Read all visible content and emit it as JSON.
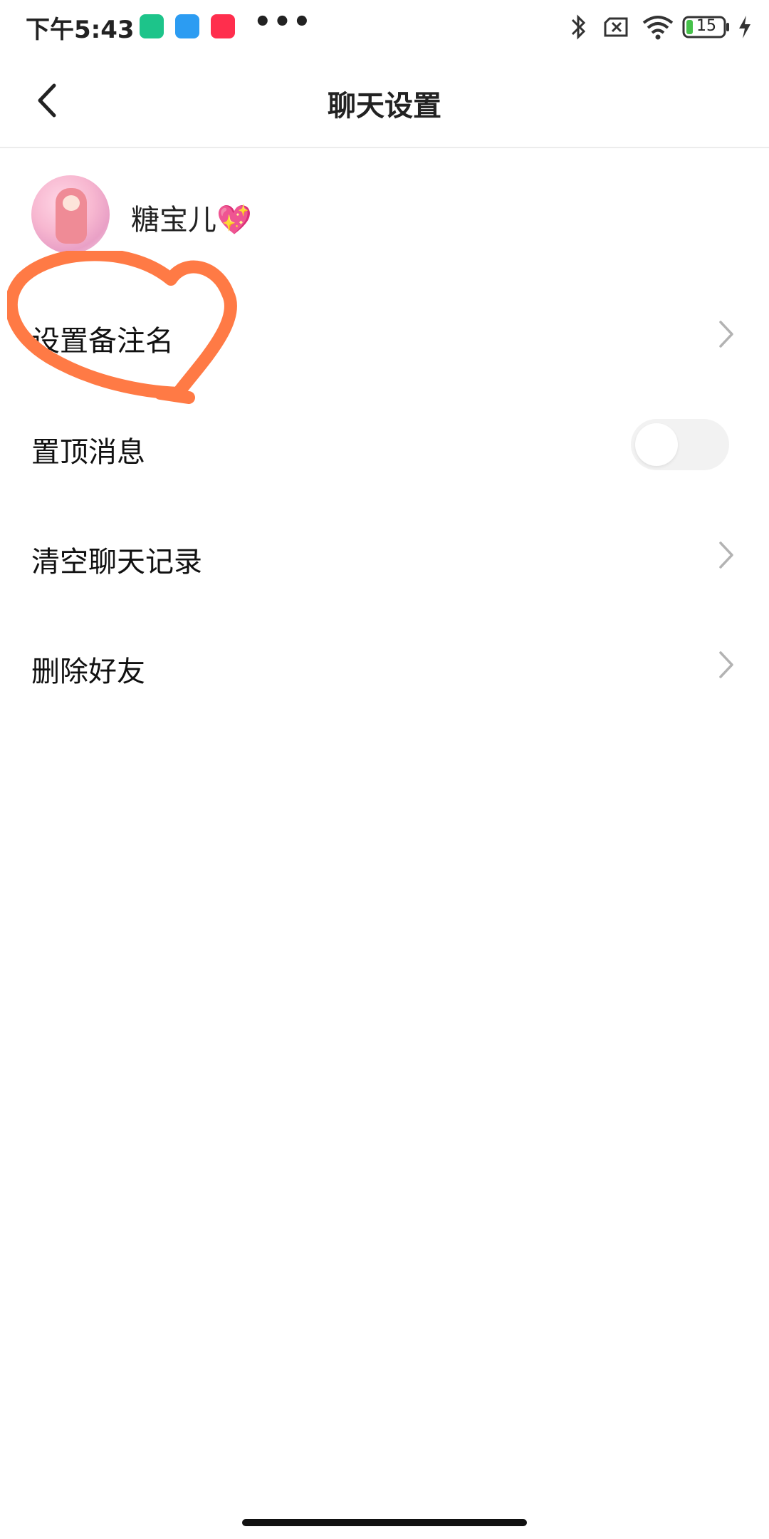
{
  "status_bar": {
    "time": "下午5:43",
    "more": "•••",
    "battery_level": "15",
    "icons": [
      "shield-app-icon",
      "blue-app-icon",
      "xiaohongshu-app-icon",
      "bluetooth-icon",
      "sim-card-icon",
      "wifi-icon",
      "battery-icon",
      "charging-icon"
    ]
  },
  "header": {
    "title": "聊天设置"
  },
  "profile": {
    "nickname": "糖宝儿💖"
  },
  "settings": {
    "remark": "设置备注名",
    "pin": "置顶消息",
    "clear_history": "清空聊天记录",
    "delete_friend": "删除好友"
  },
  "pin_toggle_on": false,
  "colors": {
    "annotation": "#ff7a45",
    "toggle_off": "#f2f2f2",
    "chevron": "#b3b3b3"
  }
}
